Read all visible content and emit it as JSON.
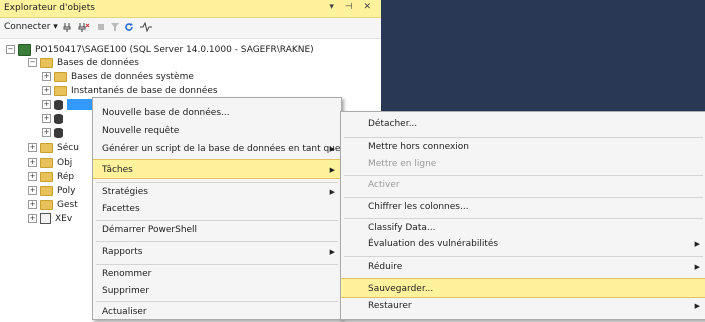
{
  "panel": {
    "title": "Explorateur d'objets",
    "controls": "▾ ⊣ ✕",
    "toolbar": {
      "connect_label": "Connecter ▾"
    }
  },
  "tree": {
    "server": "PO150417\\SAGE100 (SQL Server 14.0.1000 - SAGEFR\\RAKNE)",
    "databases": "Bases de données",
    "system_db": "Bases de données système",
    "snapshots": "Instantanés de base de données",
    "truncated": [
      "Sécu",
      "Obj",
      "Rép",
      "Poly",
      "Gest",
      "XEv"
    ]
  },
  "context_menu": {
    "items": [
      {
        "label": "Nouvelle base de données...",
        "arrow": false
      },
      {
        "label": "Nouvelle requête",
        "arrow": false
      },
      {
        "label": "Générer un script de la base de données en tant que",
        "arrow": true
      },
      {
        "label": "Tâches",
        "arrow": true,
        "highlighted": true
      },
      {
        "label": "Stratégies",
        "arrow": true
      },
      {
        "label": "Facettes",
        "arrow": false
      },
      {
        "label": "Démarrer PowerShell",
        "arrow": false
      },
      {
        "label": "Rapports",
        "arrow": true
      },
      {
        "label": "Renommer",
        "arrow": false
      },
      {
        "label": "Supprimer",
        "arrow": false
      },
      {
        "label": "Actualiser",
        "arrow": false
      }
    ]
  },
  "submenu": {
    "items": [
      {
        "label": "Détacher...",
        "arrow": false
      },
      {
        "label": "Mettre hors connexion",
        "arrow": false
      },
      {
        "label": "Mettre en ligne",
        "arrow": false,
        "disabled": true
      },
      {
        "label": "Activer",
        "arrow": false,
        "disabled": true
      },
      {
        "label": "Chiffrer les colonnes...",
        "arrow": false
      },
      {
        "label": "Classify Data...",
        "arrow": false
      },
      {
        "label": "Évaluation des vulnérabilités",
        "arrow": true
      },
      {
        "label": "Réduire",
        "arrow": true
      },
      {
        "label": "Sauvegarder...",
        "arrow": false,
        "highlighted": true
      },
      {
        "label": "Restaurer",
        "arrow": true
      }
    ]
  },
  "arrow_glyph": "▶",
  "colors": {
    "highlight": "#fff29d",
    "selection": "#3399ff",
    "background_dark": "#293955"
  }
}
